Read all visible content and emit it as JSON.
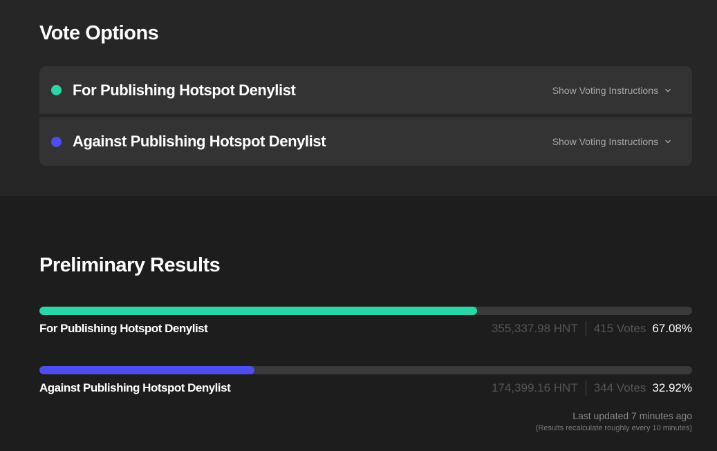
{
  "vote_options": {
    "title": "Vote Options",
    "options": [
      {
        "label": "For Publishing Hotspot Denylist",
        "color": "#2ad6a8",
        "instructions_label": "Show Voting Instructions"
      },
      {
        "label": "Against Publishing Hotspot Denylist",
        "color": "#4d4df0",
        "instructions_label": "Show Voting Instructions"
      }
    ]
  },
  "results": {
    "title": "Preliminary Results",
    "items": [
      {
        "label": "For Publishing Hotspot Denylist",
        "hnt": "355,337.98 HNT",
        "votes": "415 Votes",
        "percent_text": "67.08%",
        "percent": 67.08,
        "color": "#2ad6a8"
      },
      {
        "label": "Against Publishing Hotspot Denylist",
        "hnt": "174,399.16 HNT",
        "votes": "344 Votes",
        "percent_text": "32.92%",
        "percent": 32.92,
        "color": "#4d4df0"
      }
    ],
    "last_updated": "Last updated 7 minutes ago",
    "recalc_note": "(Results recalculate roughly every 10 minutes)"
  },
  "icons": {
    "option_marker": "dot-icon",
    "expand": "chevron-down-icon"
  },
  "colors": {
    "background": "#1d1d1d",
    "panel": "#262626",
    "row": "#333333",
    "track": "#3a3a3a"
  }
}
